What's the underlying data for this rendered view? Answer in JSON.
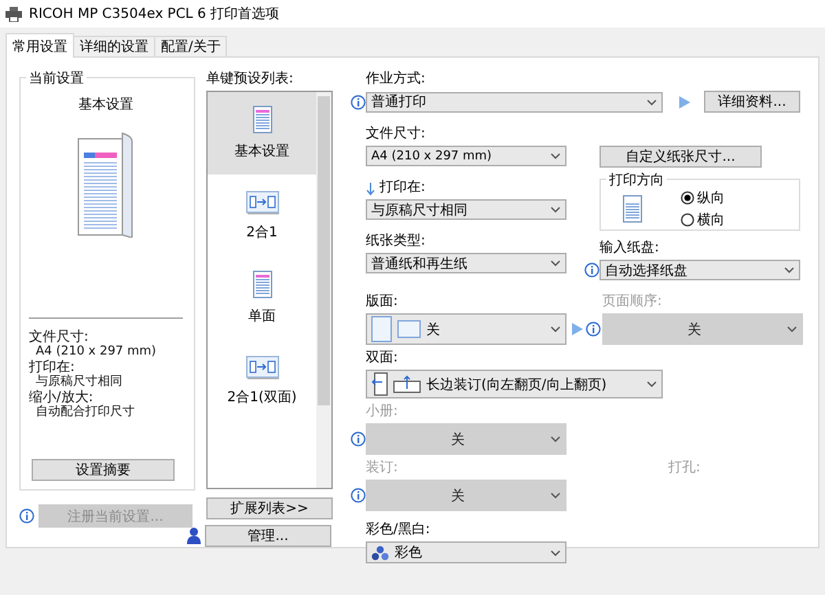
{
  "window": {
    "title": "RICOH MP C3504ex PCL 6 打印首选项"
  },
  "tabs": [
    {
      "label": "常用设置",
      "selected": true
    },
    {
      "label": "详细的设置",
      "selected": false
    },
    {
      "label": "配置/关于",
      "selected": false
    }
  ],
  "current_settings": {
    "title": "当前设置",
    "preset_name": "基本设置",
    "summary": [
      {
        "kind": "heading",
        "text": "文件尺寸:"
      },
      {
        "kind": "value",
        "text": "A4 (210 x 297 mm)"
      },
      {
        "kind": "heading",
        "text": "打印在:"
      },
      {
        "kind": "value",
        "text": "与原稿尺寸相同"
      },
      {
        "kind": "heading",
        "text": "缩小/放大:"
      },
      {
        "kind": "value",
        "text": "自动配合打印尺寸"
      }
    ],
    "summary_button": "设置摘要",
    "register_button": {
      "label": "注册当前设置...",
      "disabled": true
    }
  },
  "preset_list": {
    "label": "单键预设列表:",
    "items": [
      {
        "label": "基本设置",
        "kind": "document",
        "selected": true
      },
      {
        "label": "2合1",
        "kind": "two-up",
        "selected": false
      },
      {
        "label": "单面",
        "kind": "document",
        "selected": false
      },
      {
        "label": "2合1(双面)",
        "kind": "two-up",
        "selected": false
      }
    ],
    "expand_button": "扩展列表>>",
    "manage_button": "管理..."
  },
  "job_type": {
    "label": "作业方式:",
    "value": "普通打印",
    "info": true,
    "detail_button": "详细资料..."
  },
  "paper_size": {
    "label": "文件尺寸:",
    "value": "A4 (210 x 297 mm)",
    "custom_button": "自定义纸张尺寸..."
  },
  "print_on": {
    "label": "打印在:",
    "value": "与原稿尺寸相同"
  },
  "orientation": {
    "title": "打印方向",
    "options": [
      {
        "label": "纵向",
        "selected": true
      },
      {
        "label": "横向",
        "selected": false
      }
    ]
  },
  "paper_type": {
    "label": "纸张类型:",
    "value": "普通纸和再生纸"
  },
  "input_tray": {
    "label": "输入纸盘:",
    "value": "自动选择纸盘",
    "info": true
  },
  "layout": {
    "label": "版面:",
    "value": "关",
    "disabled": false
  },
  "page_order": {
    "label": "页面顺序:",
    "value": "关",
    "info": true,
    "disabled": true
  },
  "duplex": {
    "label": "双面:",
    "value": "长边装订(向左翻页/向上翻页)",
    "disabled": false
  },
  "booklet": {
    "label": "小册:",
    "value": "关",
    "info": true,
    "disabled": true
  },
  "staple": {
    "label": "装订:",
    "value": "关",
    "info": true,
    "disabled": true
  },
  "punch": {
    "label": "打孔:",
    "disabled": true
  },
  "color_mode": {
    "label": "彩色/黑白:",
    "value": "彩色",
    "disabled": false
  }
}
